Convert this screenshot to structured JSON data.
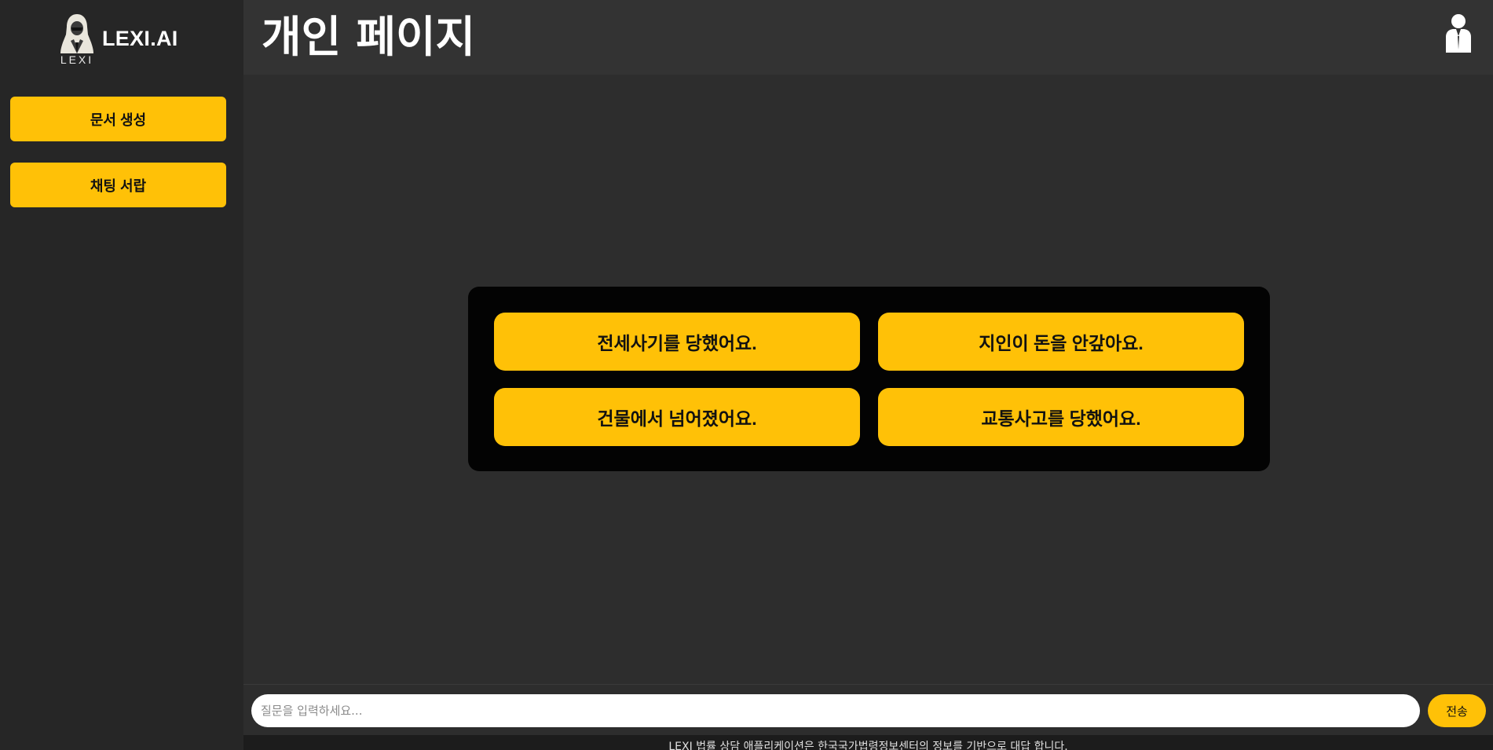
{
  "sidebar": {
    "logo": {
      "name": "LEXI.AI",
      "sub": "LEXI",
      "icon": "hooded-figure-logo"
    },
    "items": [
      {
        "label": "문서 생성"
      },
      {
        "label": "채팅 서랍"
      }
    ]
  },
  "header": {
    "title": "개인 페이지",
    "user_icon": "user-icon"
  },
  "main": {
    "suggestions": [
      {
        "label": "전세사기를 당했어요."
      },
      {
        "label": "지인이 돈을 안갚아요."
      },
      {
        "label": "건물에서 넘어졌어요."
      },
      {
        "label": "교통사고를 당했어요."
      }
    ]
  },
  "chat": {
    "placeholder": "질문을 입력하세요...",
    "value": "",
    "send_label": "전송"
  },
  "footer": {
    "text": "LEXI 법률 상담 애플리케이션은 한국국가법령정보센터의 정보를 기반으로 대답 합니다."
  },
  "colors": {
    "accent": "#ffc107",
    "sidebar_bg": "#262626",
    "header_bg": "#333333",
    "main_bg": "#2d2d2d",
    "suggest_panel_bg": "#030303"
  }
}
